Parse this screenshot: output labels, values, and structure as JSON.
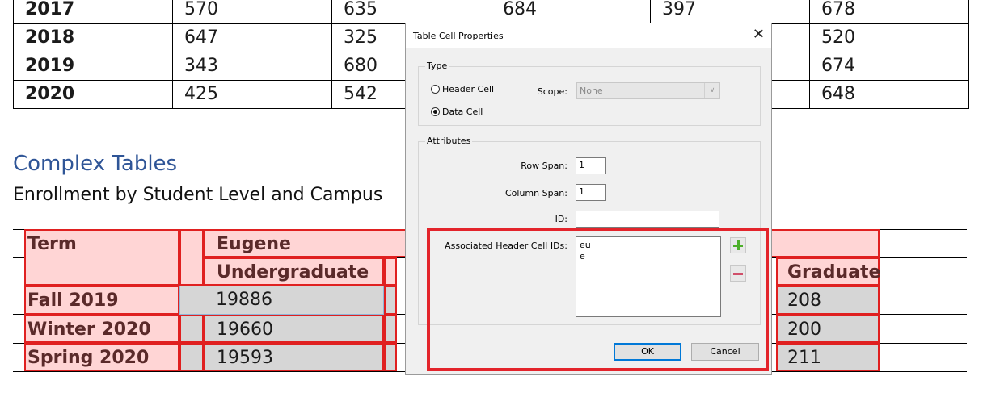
{
  "top_table": {
    "rows": [
      {
        "year": "2017",
        "values": [
          "570",
          "635",
          "684",
          "397",
          "678"
        ]
      },
      {
        "year": "2018",
        "values": [
          "647",
          "325",
          "",
          "",
          "520"
        ]
      },
      {
        "year": "2019",
        "values": [
          "343",
          "680",
          "",
          "",
          "674"
        ]
      },
      {
        "year": "2020",
        "values": [
          "425",
          "542",
          "",
          "",
          "648"
        ]
      }
    ]
  },
  "section_title": "Complex Tables",
  "table_caption": "Enrollment by Student Level and Campus",
  "complex_table": {
    "header_term": "Term",
    "header_campus": "Eugene",
    "header_undergrad": "Undergraduate",
    "header_graduate": "Graduate",
    "rows": [
      {
        "term": "Fall 2019",
        "undergrad": "19886",
        "graduate": "208"
      },
      {
        "term": "Winter 2020",
        "undergrad": "19660",
        "graduate": "200"
      },
      {
        "term": "Spring 2020",
        "undergrad": "19593",
        "graduate": "211"
      }
    ]
  },
  "dialog": {
    "title": "Table Cell Properties",
    "close_glyph": "✕",
    "type_group": "Type",
    "header_cell": "Header Cell",
    "data_cell": "Data Cell",
    "scope_label": "Scope:",
    "scope_value": "None",
    "attributes_group": "Attributes",
    "row_span_label": "Row Span:",
    "row_span_value": "1",
    "col_span_label": "Column Span:",
    "col_span_value": "1",
    "id_label": "ID:",
    "id_value": "",
    "assoc_label": "Associated Header Cell IDs:",
    "assoc_ids": [
      "eu",
      "e"
    ],
    "ok_label": "OK",
    "cancel_label": "Cancel"
  },
  "colors": {
    "highlight_red": "#e3242b",
    "heading_blue": "#2f5597",
    "cell_pink": "#ffd5d5",
    "cell_gray": "#d6d6d6"
  }
}
